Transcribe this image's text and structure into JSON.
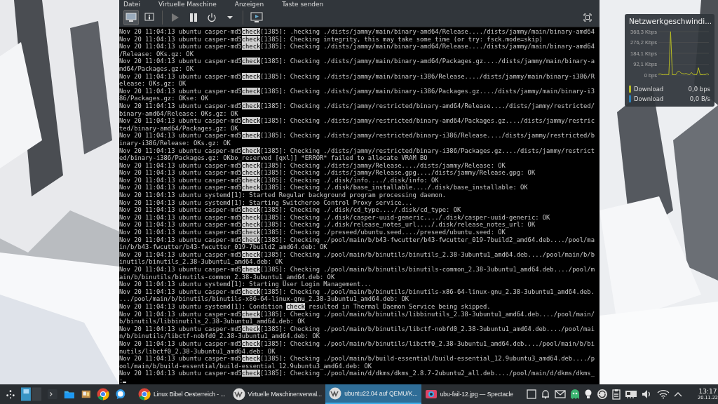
{
  "window": {
    "menu": [
      "Datei",
      "Virtuelle Maschine",
      "Anzeigen",
      "Taste senden"
    ],
    "toolbar": [
      {
        "kind": "monitor",
        "selected": true,
        "disabled": false
      },
      {
        "kind": "info",
        "selected": false,
        "disabled": false
      },
      {
        "kind": "separator"
      },
      {
        "kind": "play",
        "selected": false,
        "disabled": true
      },
      {
        "kind": "pause",
        "selected": false,
        "disabled": false
      },
      {
        "kind": "power",
        "selected": false,
        "disabled": false
      },
      {
        "kind": "caret",
        "selected": false,
        "disabled": false
      },
      {
        "kind": "separator"
      },
      {
        "kind": "screen",
        "selected": false,
        "disabled": false
      },
      {
        "kind": "spacer"
      },
      {
        "kind": "fullscreen",
        "selected": false,
        "disabled": false
      }
    ],
    "console": {
      "rows": [
        {
          "before": "Nov 20 11:04:13 ubuntu casper-md5",
          "highlighted": "check",
          "after": "[1385]: .hecking ./dists/jammy/main/binary-amd64/Release..../dists/jammy/main/binary-amd64"
        },
        {
          "before": "Nov 20 11:04:13 ubuntu casper-md5",
          "highlighted": "check",
          "after": "[1385]: Checking integrity, this may take some time (or try: fsck.mode=skip)"
        },
        {
          "before": "Nov 20 11:04:13 ubuntu casper-md5",
          "highlighted": "check",
          "after": "[1385]: Checking ./dists/jammy/main/binary-amd64/Release..../dists/jammy/main/binary-amd64"
        },
        {
          "text": "/Release: OKs.gz: OK"
        },
        {
          "before": "Nov 20 11:04:13 ubuntu casper-md5",
          "highlighted": "check",
          "after": "[1385]: Checking ./dists/jammy/main/binary-amd64/Packages.gz..../dists/jammy/main/binary-a"
        },
        {
          "text": "md64/Packages.gz: OK"
        },
        {
          "before": "Nov 20 11:04:13 ubuntu casper-md5",
          "highlighted": "check",
          "after": "[1385]: Checking ./dists/jammy/main/binary-i386/Release..../dists/jammy/main/binary-i386/R"
        },
        {
          "text": "elease: OKs.gz: OK"
        },
        {
          "before": "Nov 20 11:04:13 ubuntu casper-md5",
          "highlighted": "check",
          "after": "[1385]: Checking ./dists/jammy/main/binary-i386/Packages.gz..../dists/jammy/main/binary-i3"
        },
        {
          "text": "86/Packages.gz: OKse: OK"
        },
        {
          "before": "Nov 20 11:04:13 ubuntu casper-md5",
          "highlighted": "check",
          "after": "[1385]: Checking ./dists/jammy/restricted/binary-amd64/Release..../dists/jammy/restricted/"
        },
        {
          "text": "binary-amd64/Release: OKs.gz: OK"
        },
        {
          "before": "Nov 20 11:04:13 ubuntu casper-md5",
          "highlighted": "check",
          "after": "[1385]: Checking ./dists/jammy/restricted/binary-amd64/Packages.gz..../dists/jammy/restric"
        },
        {
          "text": "ted/binary-amd64/Packages.gz: OK"
        },
        {
          "before": "Nov 20 11:04:13 ubuntu casper-md5",
          "highlighted": "check",
          "after": "[1385]: Checking ./dists/jammy/restricted/binary-i386/Release..../dists/jammy/restricted/b"
        },
        {
          "text": "inary-i386/Release: OKs.gz: OK"
        },
        {
          "before": "Nov 20 11:04:13 ubuntu casper-md5",
          "highlighted": "check",
          "after": "[1385]: Checking ./dists/jammy/restricted/binary-i386/Packages.gz..../dists/jammy/restrict"
        },
        {
          "text": "ed/binary-i386/Packages.gz: OKbo_reserved [qxl]] *ERROR* failed to allocate VRAM BO"
        },
        {
          "before": "Nov 20 11:04:13 ubuntu casper-md5",
          "highlighted": "check",
          "after": "[1385]: Checking ./dists/jammy/Release..../dists/jammy/Release: OK"
        },
        {
          "before": "Nov 20 11:04:13 ubuntu casper-md5",
          "highlighted": "check",
          "after": "[1385]: Checking ./dists/jammy/Release.gpg..../dists/jammy/Release.gpg: OK"
        },
        {
          "before": "Nov 20 11:04:13 ubuntu casper-md5",
          "highlighted": "check",
          "after": "[1385]: Checking ./.disk/info..../.disk/info: OK"
        },
        {
          "before": "Nov 20 11:04:13 ubuntu casper-md5",
          "highlighted": "check",
          "after": "[1385]: Checking ./.disk/base_installable..../.disk/base_installable: OK"
        },
        {
          "text": "Nov 20 11:04:13 ubuntu systemd[1]: Started Regular background program processing daemon."
        },
        {
          "text": "Nov 20 11:04:13 ubuntu systemd[1]: Starting Switcheroo Control Proxy service..."
        },
        {
          "before": "Nov 20 11:04:13 ubuntu casper-md5",
          "highlighted": "check",
          "after": "[1385]: Checking ./.disk/cd_type..../.disk/cd_type: OK"
        },
        {
          "before": "Nov 20 11:04:13 ubuntu casper-md5",
          "highlighted": "check",
          "after": "[1385]: Checking ./.disk/casper-uuid-generic..../.disk/casper-uuid-generic: OK"
        },
        {
          "before": "Nov 20 11:04:13 ubuntu casper-md5",
          "highlighted": "check",
          "after": "[1385]: Checking ./.disk/release_notes_url..../.disk/release_notes_url: OK"
        },
        {
          "before": "Nov 20 11:04:13 ubuntu casper-md5",
          "highlighted": "check",
          "after": "[1385]: Checking ./preseed/ubuntu.seed..../preseed/ubuntu.seed: OK"
        },
        {
          "before": "Nov 20 11:04:13 ubuntu casper-md5",
          "highlighted": "check",
          "after": "[1385]: Checking ./pool/main/b/b43-fwcutter/b43-fwcutter_019-7build2_amd64.deb..../pool/ma"
        },
        {
          "text": "in/b/b43-fwcutter/b43-fwcutter_019-7build2_amd64.deb: OK"
        },
        {
          "before": "Nov 20 11:04:13 ubuntu casper-md5",
          "highlighted": "check",
          "after": "[1385]: Checking ./pool/main/b/binutils/binutils_2.38-3ubuntu1_amd64.deb..../pool/main/b/b"
        },
        {
          "text": "inutils/binutils_2.38-3ubuntu1_amd64.deb: OK"
        },
        {
          "before": "Nov 20 11:04:13 ubuntu casper-md5",
          "highlighted": "check",
          "after": "[1385]: Checking ./pool/main/b/binutils/binutils-common_2.38-3ubuntu1_amd64.deb..../pool/m"
        },
        {
          "text": "ain/b/binutils/binutils-common_2.38-3ubuntu1_amd64.deb: OK"
        },
        {
          "text": "Nov 20 11:04:13 ubuntu systemd[1]: Starting User Login Management..."
        },
        {
          "before": "Nov 20 11:04:13 ubuntu casper-md5",
          "highlighted": "check",
          "after": "[1385]: Checking ./pool/main/b/binutils/binutils-x86-64-linux-gnu_2.38-3ubuntu1_amd64.deb."
        },
        {
          "text": ".../pool/main/b/binutils/binutils-x86-64-linux-gnu_2.38-3ubuntu1_amd64.deb: OK"
        },
        {
          "before": "Nov 20 11:04:13 ubuntu systemd[1]: Condition ",
          "highlighted": "check",
          "after": " resulted in Thermal Daemon Service being skipped."
        },
        {
          "before": "Nov 20 11:04:13 ubuntu casper-md5",
          "highlighted": "check",
          "after": "[1385]: Checking ./pool/main/b/binutils/libbinutils_2.38-3ubuntu1_amd64.deb..../pool/main/"
        },
        {
          "text": "b/binutils/libbinutils_2.38-3ubuntu1_amd64.deb: OK"
        },
        {
          "before": "Nov 20 11:04:13 ubuntu casper-md5",
          "highlighted": "check",
          "after": "[1385]: Checking ./pool/main/b/binutils/libctf-nobfd0_2.38-3ubuntu1_amd64.deb..../pool/mai"
        },
        {
          "text": "n/b/binutils/libctf-nobfd0_2.38-3ubuntu1_amd64.deb: OK"
        },
        {
          "before": "Nov 20 11:04:13 ubuntu casper-md5",
          "highlighted": "check",
          "after": "[1385]: Checking ./pool/main/b/binutils/libctf0_2.38-3ubuntu1_amd64.deb..../pool/main/b/bi"
        },
        {
          "text": "nutils/libctf0_2.38-3ubuntu1_amd64.deb: OK"
        },
        {
          "before": "Nov 20 11:04:13 ubuntu casper-md5",
          "highlighted": "check",
          "after": "[1385]: Checking ./pool/main/b/build-essential/build-essential_12.9ubuntu3_amd64.deb..../p"
        },
        {
          "text": "ool/main/b/build-essential/build-essential_12.9ubuntu3_amd64.deb: OK"
        },
        {
          "before": "Nov 20 11:04:13 ubuntu casper-md5",
          "highlighted": "check",
          "after": "[1385]: Checking ./pool/main/d/dkms/dkms_2.8.7-2ubuntu2_all.deb..../pool/main/d/dkms/dkms_"
        },
        {
          "text": ":"
        }
      ]
    }
  },
  "network_widget": {
    "title": "Netzwerkgeschwindi...",
    "chart_data": {
      "type": "line",
      "ylim": [
        0,
        368.3
      ],
      "yticks": [
        {
          "value": 0,
          "label": "0 bps"
        },
        {
          "value": 92.1,
          "label": "92,1 Kbps"
        },
        {
          "value": 184.1,
          "label": "184,1 Kbps"
        },
        {
          "value": 276.2,
          "label": "276,2 Kbps"
        },
        {
          "value": 368.3,
          "label": "368,3 Kbps"
        }
      ],
      "grid": true,
      "series": [
        {
          "color": "#b8bc24",
          "values": [
            6,
            10,
            4,
            3,
            5,
            4,
            3,
            368,
            3,
            4,
            3,
            28,
            32,
            18,
            12,
            10,
            14,
            6,
            4,
            22,
            5,
            4,
            3,
            62,
            4,
            3,
            5,
            4,
            12,
            3
          ]
        }
      ]
    },
    "legend": [
      {
        "label": "Download",
        "value": "0,0 bps",
        "color": "#b8bc24"
      },
      {
        "label": "Download",
        "value": "0,0 B/s",
        "color": "#2a7fb8"
      }
    ]
  },
  "taskbar": {
    "launchers": [
      {
        "kind": "launcher"
      },
      {
        "kind": "pager"
      },
      {
        "kind": "terminal"
      },
      {
        "kind": "folder"
      },
      {
        "kind": "files"
      },
      {
        "kind": "chrome"
      },
      {
        "kind": "chat"
      }
    ],
    "tasks": [
      {
        "kind": "chrome",
        "label": "Linux Bibel Oesterreich - ...",
        "selected": false
      },
      {
        "kind": "vm",
        "label": "Virtuelle Maschinenverwal...",
        "selected": false
      },
      {
        "kind": "vm",
        "label": "ubuntu22.04 auf QEMU/K...",
        "selected": true
      },
      {
        "kind": "spectacle",
        "label": "ubu-fail-12.jpg — Spectacle",
        "selected": false
      }
    ],
    "tray": [
      {
        "kind": "square"
      },
      {
        "kind": "bell"
      },
      {
        "kind": "mail"
      },
      {
        "kind": "ghost"
      },
      {
        "kind": "bulb"
      },
      {
        "kind": "sync"
      },
      {
        "kind": "clipboard"
      },
      {
        "kind": "card"
      },
      {
        "kind": "volume"
      },
      {
        "kind": "wifi"
      },
      {
        "kind": "caret"
      }
    ],
    "clock": {
      "time": "13:17",
      "date": "20.11.22"
    }
  }
}
